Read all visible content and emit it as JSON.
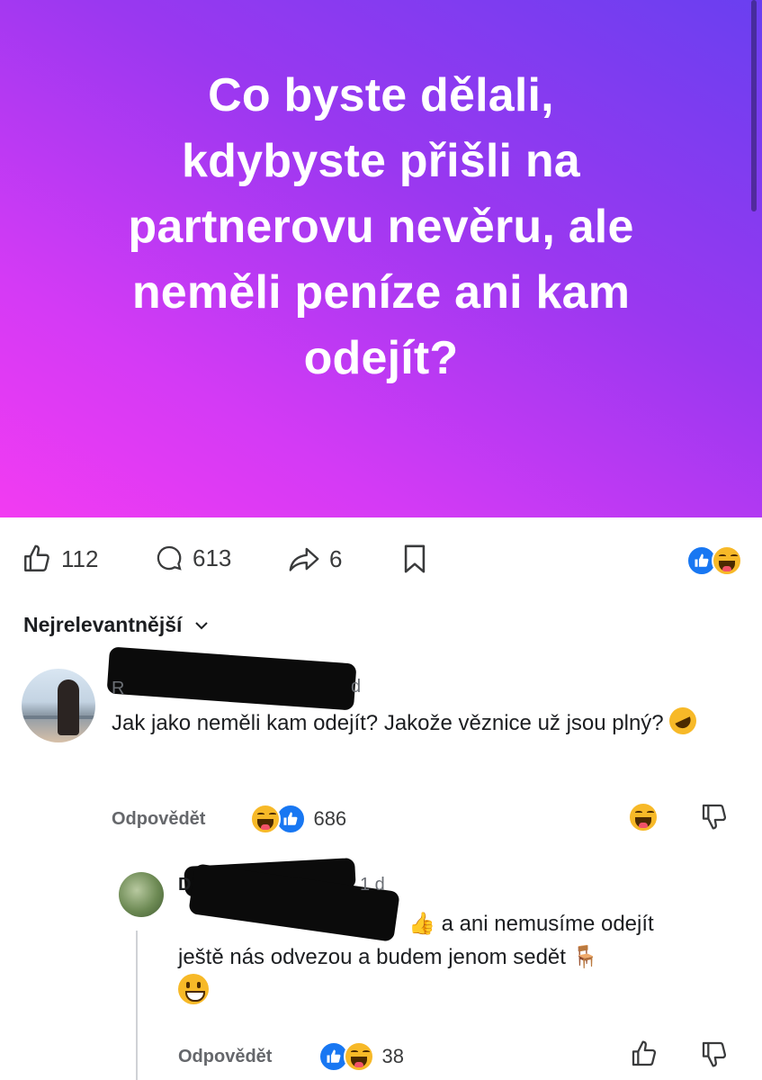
{
  "post": {
    "text": "Co byste dělali,\nkdybyste přišli na\npartnerovu nevěru, ale\nneměli peníze ani kam\nodejít?"
  },
  "actions": {
    "likes": "112",
    "comments": "613",
    "shares": "6"
  },
  "sort": {
    "label": "Nejrelevantnější"
  },
  "comments": [
    {
      "visible_name_fragment": "R",
      "visible_time_fragment": "d",
      "text": "Jak jako neměli kam odejít? Jakože věznice už jsou plný?",
      "emoji": "🤣",
      "reply_label": "Odpovědět",
      "reaction_count": "686"
    },
    {
      "visible_name_fragment": "D",
      "visible_time_fragment": "1 d",
      "text_line1": "a ani nemusíme odejít",
      "text_line2": "ještě nás odvezou a budem jenom sedět",
      "emoji_thumb": "👍",
      "emoji_chair": "🪑",
      "emoji_smile": "😀",
      "reply_label": "Odpovědět",
      "reaction_count": "38"
    }
  ],
  "colors": {
    "gradient_top": "#6a3ff0",
    "gradient_bottom": "#f23bf2",
    "facebook_blue": "#1877f2",
    "reaction_yellow": "#f7b928"
  }
}
